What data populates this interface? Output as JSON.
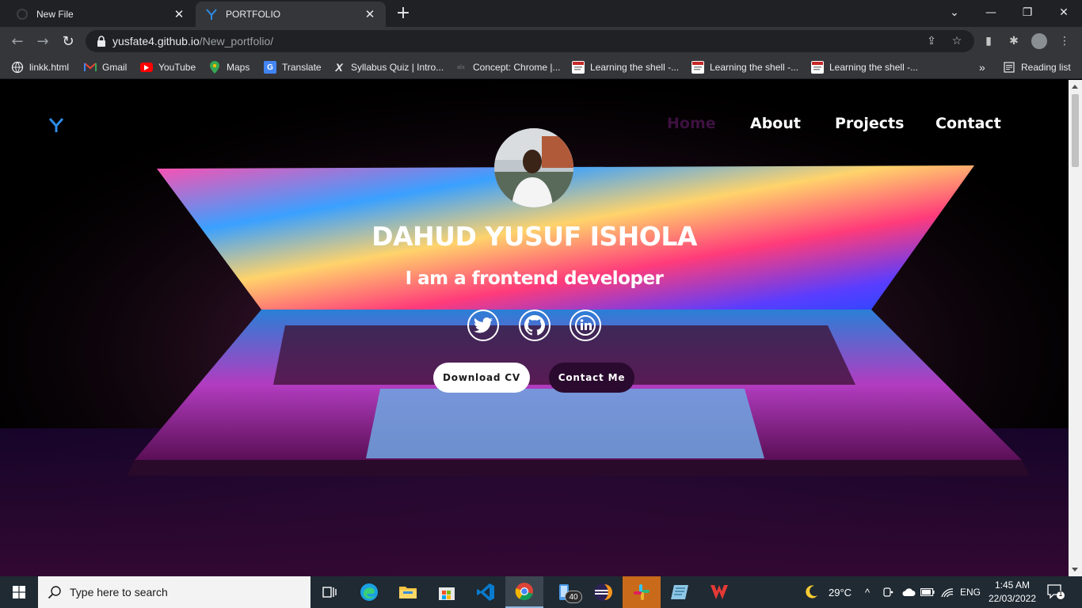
{
  "browser": {
    "tabs": [
      {
        "title": "New File",
        "active": false
      },
      {
        "title": "PORTFOLIO",
        "active": true
      }
    ],
    "new_tab": "+",
    "url_host": "yusfate4.github.io",
    "url_path": "/New_portfolio/",
    "bookmarks": [
      {
        "label": "linkk.html",
        "icon": "globe-icon"
      },
      {
        "label": "Gmail",
        "icon": "gmail-icon"
      },
      {
        "label": "YouTube",
        "icon": "youtube-icon"
      },
      {
        "label": "Maps",
        "icon": "maps-icon"
      },
      {
        "label": "Translate",
        "icon": "translate-icon"
      },
      {
        "label": "Syllabus Quiz | Intro...",
        "icon": "x-icon"
      },
      {
        "label": "Concept: Chrome |...",
        "icon": "alx-icon"
      },
      {
        "label": "Learning the shell -...",
        "icon": "page-icon"
      },
      {
        "label": "Learning the shell -...",
        "icon": "page-icon"
      },
      {
        "label": "Learning the shell -...",
        "icon": "page-icon"
      }
    ],
    "bookmarks_overflow": "»",
    "reading_list": "Reading list"
  },
  "site": {
    "logo": "Y",
    "nav": [
      {
        "label": "Home"
      },
      {
        "label": "About"
      },
      {
        "label": "Projects"
      },
      {
        "label": "Contact"
      }
    ],
    "name": "DAHUD YUSUF ISHOLA",
    "role": "I am a frontend developer",
    "social": [
      "twitter-icon",
      "github-icon",
      "linkedin-icon"
    ],
    "buttons": {
      "download_cv": "Download CV",
      "contact_me": "Contact Me"
    }
  },
  "taskbar": {
    "search_placeholder": "Type here to search",
    "badge_count": "40",
    "weather": "29°C",
    "language": "ENG",
    "time": "1:45 AM",
    "date": "22/03/2022",
    "notification_count": "1"
  },
  "colors": {
    "home_link": "#3d1140",
    "logo_blue": "#2d8ce8",
    "contact_button": "#2a0a2e"
  }
}
